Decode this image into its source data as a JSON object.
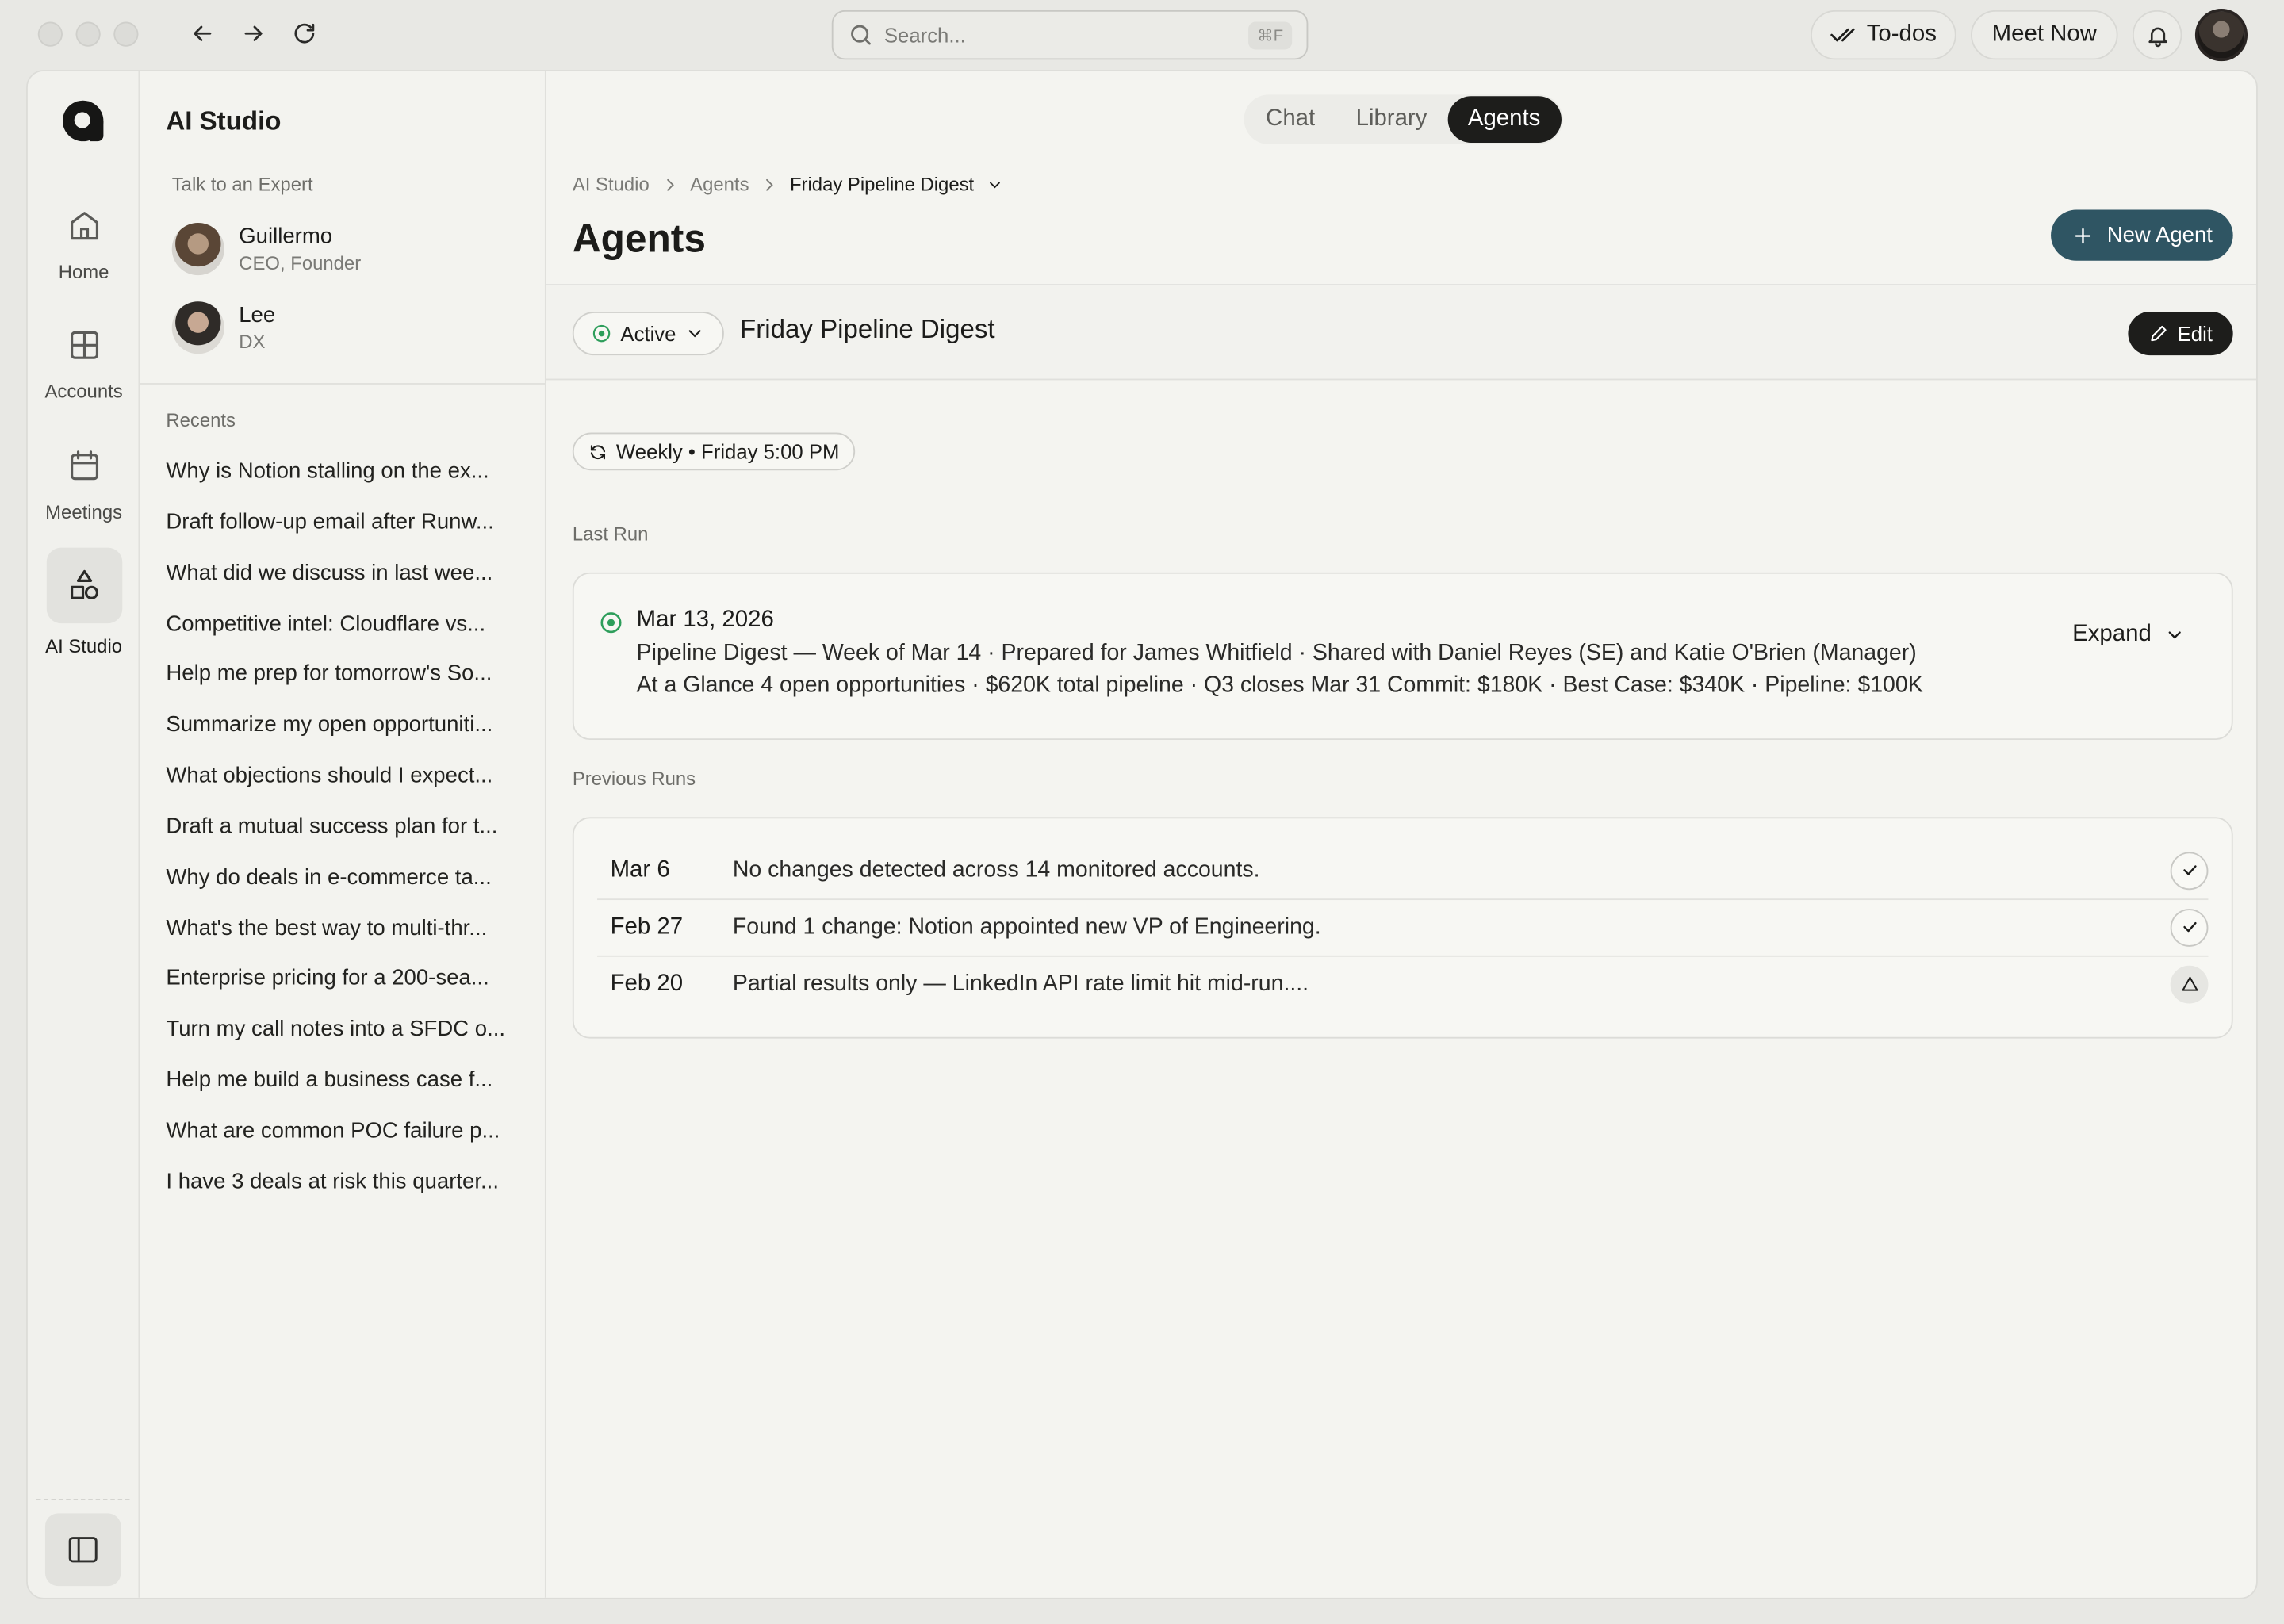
{
  "topbar": {
    "search_placeholder": "Search...",
    "search_shortcut": "⌘F",
    "todos_label": "To-dos",
    "meet_now_label": "Meet Now"
  },
  "rail": {
    "items": [
      {
        "label": "Home",
        "icon": "home-icon"
      },
      {
        "label": "Accounts",
        "icon": "grid-icon"
      },
      {
        "label": "Meetings",
        "icon": "calendar-icon"
      },
      {
        "label": "AI Studio",
        "icon": "shapes-icon",
        "active": true
      }
    ]
  },
  "sidebar": {
    "title": "AI Studio",
    "experts_heading": "Talk to an Expert",
    "experts": [
      {
        "name": "Guillermo",
        "role": "CEO, Founder"
      },
      {
        "name": "Lee",
        "role": "DX"
      }
    ],
    "recents_heading": "Recents",
    "recents": [
      "Why is Notion stalling on the ex...",
      "Draft follow-up email after Runw...",
      "What did we discuss in last wee...",
      "Competitive intel: Cloudflare vs...",
      "Help me prep for tomorrow's So...",
      "Summarize my open opportuniti...",
      "What objections should I expect...",
      "Draft a mutual success plan for t...",
      "Why do deals in e-commerce ta...",
      "What's the best way to multi-thr...",
      "Enterprise pricing for a 200-sea...",
      "Turn my call notes into a SFDC o...",
      "Help me build a business case f...",
      "What are common POC failure p...",
      "I have 3 deals at risk this quarter..."
    ]
  },
  "main": {
    "tabs": [
      "Chat",
      "Library",
      "Agents"
    ],
    "active_tab": "Agents",
    "breadcrumb": [
      "AI Studio",
      "Agents",
      "Friday Pipeline Digest"
    ],
    "title": "Agents",
    "new_agent_label": "New Agent",
    "agent": {
      "status": "Active",
      "name": "Friday Pipeline Digest",
      "edit_label": "Edit",
      "schedule": "Weekly • Friday 5:00 PM"
    },
    "last_run_label": "Last Run",
    "last_run": {
      "date": "Mar 13, 2026",
      "line1": "Pipeline Digest — Week of Mar 14 · Prepared for James Whitfield · Shared with Daniel Reyes (SE) and Katie O'Brien (Manager)",
      "line2": "At a Glance 4 open opportunities · $620K total pipeline · Q3 closes Mar 31 Commit: $180K · Best Case: $340K · Pipeline: $100K",
      "expand_label": "Expand"
    },
    "previous_runs_label": "Previous Runs",
    "previous_runs": [
      {
        "date": "Mar 6",
        "text": "No changes detected across 14 monitored accounts.",
        "status": "success"
      },
      {
        "date": "Feb 27",
        "text": "Found 1 change: Notion appointed new VP of Engineering.",
        "status": "success"
      },
      {
        "date": "Feb 20",
        "text": "Partial results only — LinkedIn API rate limit hit mid-run....",
        "status": "warning"
      }
    ]
  },
  "colors": {
    "accent": "#2f5563",
    "success": "#2e9e5b",
    "dark": "#1d1d1b"
  }
}
